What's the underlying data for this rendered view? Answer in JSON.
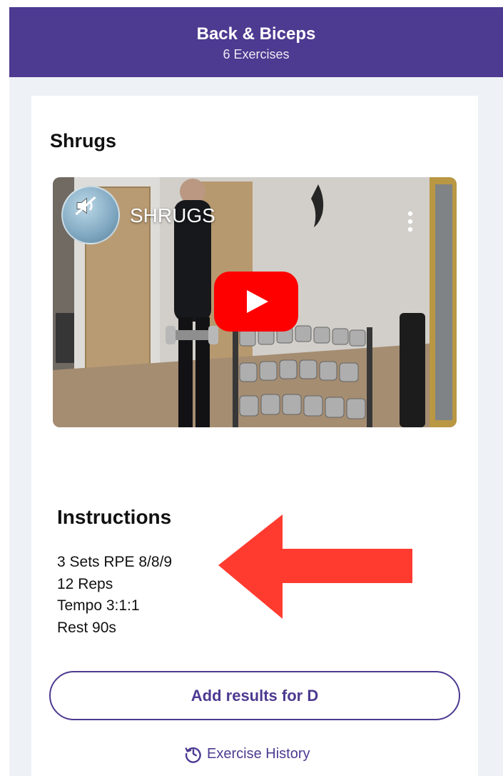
{
  "header": {
    "title": "Back & Biceps",
    "subtitle": "6 Exercises"
  },
  "exercise": {
    "name": "Shrugs"
  },
  "video": {
    "title": "SHRUGS",
    "play_icon": "youtube-play-icon",
    "mute_icon": "speaker-muted-icon",
    "more_icon": "more-vertical-icon"
  },
  "instructions": {
    "heading": "Instructions",
    "lines": [
      "3 Sets RPE 8/8/9",
      "12 Reps",
      "Tempo 3:1:1",
      "Rest 90s"
    ]
  },
  "actions": {
    "add_results_label": "Add results for D",
    "history_label": "Exercise History",
    "history_icon": "history-clock-icon"
  },
  "colors": {
    "brand": "#4d3a91",
    "background": "#eef2f6",
    "play": "#ff0000",
    "annotation_arrow": "#ff3b30"
  }
}
